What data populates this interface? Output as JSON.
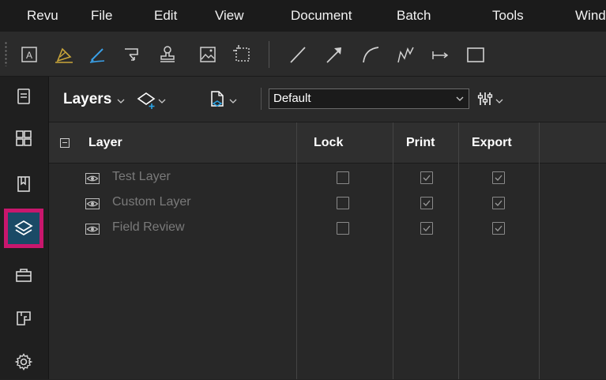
{
  "menubar": {
    "items": [
      "Revu",
      "File",
      "Edit",
      "View",
      "Document",
      "Batch",
      "Tools",
      "Wind"
    ]
  },
  "toolbar": {
    "icons": [
      "text-box-icon",
      "highlighter-icon",
      "pen-icon",
      "callout-icon",
      "stamp-icon",
      "image-icon",
      "snapshot-icon",
      "line-icon",
      "arrow-icon",
      "arc-icon",
      "polyline-icon",
      "dimension-icon",
      "rectangle-icon"
    ]
  },
  "sidebar": {
    "items": [
      "thumbnails-icon",
      "grid-icon",
      "bookmarks-icon",
      "layers-icon",
      "toolchest-icon",
      "spaces-icon",
      "settings-icon"
    ],
    "active": "layers-icon"
  },
  "layers_panel": {
    "title": "Layers",
    "preset_value": "Default",
    "columns": [
      "Layer",
      "Lock",
      "Print",
      "Export"
    ],
    "rows": [
      {
        "name": "Test Layer",
        "lock": false,
        "print": true,
        "export": true
      },
      {
        "name": "Custom Layer",
        "lock": false,
        "print": true,
        "export": true
      },
      {
        "name": "Field Review",
        "lock": false,
        "print": true,
        "export": true
      }
    ]
  },
  "colors": {
    "accent_active_border": "#c8176d",
    "active_bg": "#1a4a66"
  }
}
